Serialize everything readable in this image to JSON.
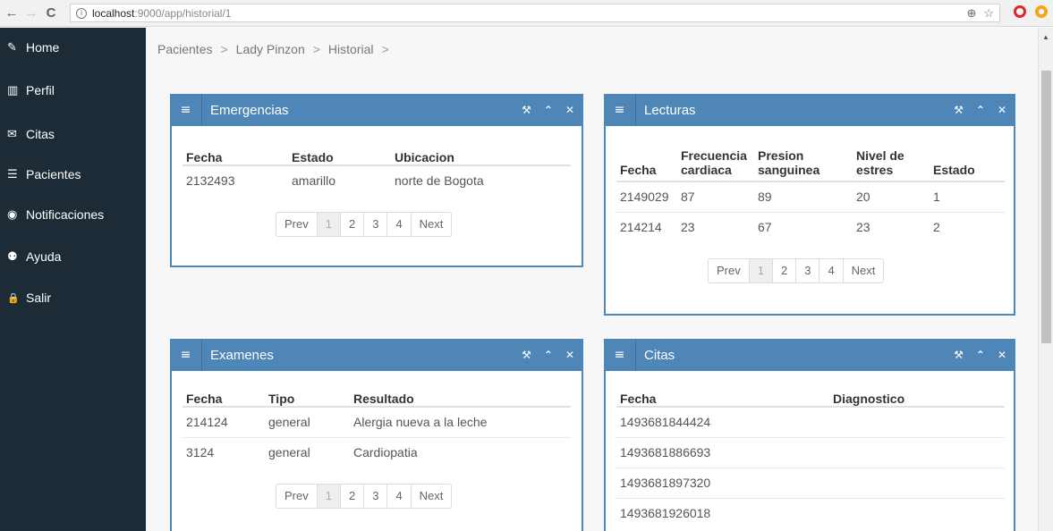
{
  "browser": {
    "back": "←",
    "forward": "→",
    "reload": "C",
    "url_host": "localhost",
    "url_path": ":9000/app/historial/1"
  },
  "sidebar": {
    "items": [
      {
        "icon": "edit-icon",
        "glyph": "✎",
        "label": "Home"
      },
      {
        "icon": "chart-icon",
        "glyph": "▥",
        "label": "Perfil"
      },
      {
        "icon": "envelope-icon",
        "glyph": "✉",
        "label": "Citas"
      },
      {
        "icon": "list-icon",
        "glyph": "☰",
        "label": "Pacientes"
      },
      {
        "icon": "eye-icon",
        "glyph": "◉",
        "label": "Notificaciones"
      },
      {
        "icon": "users-icon",
        "glyph": "⚉",
        "label": "Ayuda"
      },
      {
        "icon": "lock-icon",
        "glyph": "🔒",
        "label": "Salir"
      }
    ]
  },
  "breadcrumb": [
    "Pacientes",
    "Lady Pinzon",
    "Historial"
  ],
  "breadcrumb_sep": ">",
  "panel_tools": {
    "wrench": "⚒",
    "collapse": "⌃",
    "close": "✕"
  },
  "pager": {
    "prev": "Prev",
    "pages": [
      "1",
      "2",
      "3",
      "4"
    ],
    "next": "Next"
  },
  "emergencias": {
    "title": "Emergencias",
    "columns": [
      "Fecha",
      "Estado",
      "Ubicacion"
    ],
    "rows": [
      [
        "2132493",
        "amarillo",
        "norte de Bogota"
      ]
    ]
  },
  "lecturas": {
    "title": "Lecturas",
    "columns": [
      "Fecha",
      "Frecuencia cardiaca",
      "Presion sanguinea",
      "Nivel de estres",
      "Estado"
    ],
    "rows": [
      [
        "2149029",
        "87",
        "89",
        "20",
        "1"
      ],
      [
        "214214",
        "23",
        "67",
        "23",
        "2"
      ]
    ]
  },
  "examenes": {
    "title": "Examenes",
    "columns": [
      "Fecha",
      "Tipo",
      "Resultado"
    ],
    "rows": [
      [
        "214124",
        "general",
        "Alergia nueva a la leche"
      ],
      [
        "3124",
        "general",
        "Cardiopatia"
      ]
    ]
  },
  "citas": {
    "title": "Citas",
    "columns": [
      "Fecha",
      "Diagnostico"
    ],
    "rows": [
      [
        "1493681844424",
        ""
      ],
      [
        "1493681886693",
        ""
      ],
      [
        "1493681897320",
        ""
      ],
      [
        "1493681926018",
        ""
      ]
    ]
  },
  "colors": {
    "sidebar": "#1c2b36",
    "panel_header": "#4e86b7",
    "background": "#f7f7f7"
  }
}
